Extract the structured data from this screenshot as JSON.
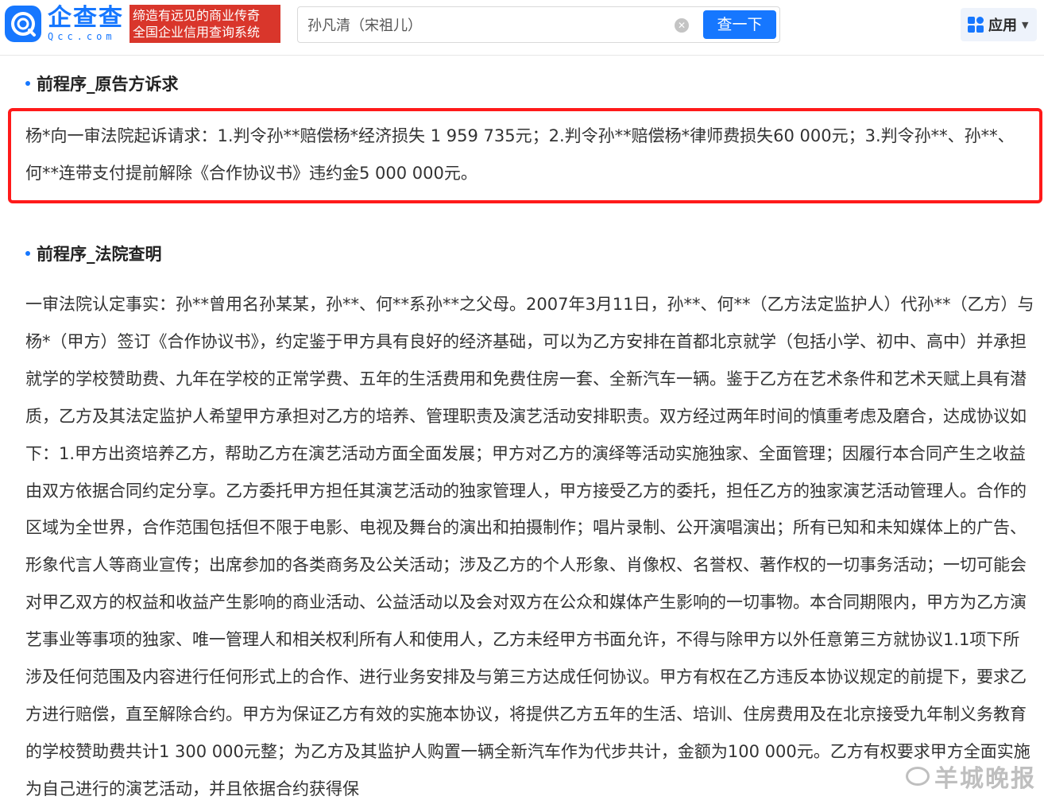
{
  "header": {
    "logo_cn": "企查查",
    "logo_en": "Qcc.com",
    "slogan_line1": "缔造有远见的商业传奇",
    "slogan_line2": "全国企业信用查询系统",
    "search_value": "孙凡清（宋祖儿）",
    "search_button": "查一下",
    "apps_label": "应用",
    "brand_color": "#1677ff",
    "slogan_color": "#d9362b"
  },
  "sections": {
    "plaintiff_title": "前程序_原告方诉求",
    "plaintiff_claim": "杨*向一审法院起诉请求：1.判令孙**赔偿杨*经济损失 1 959 735元；2.判令孙**赔偿杨*律师费损失60 000元；3.判令孙**、孙**、何**连带支付提前解除《合作协议书》违约金5 000 000元。",
    "court_title": "前程序_法院查明",
    "court_facts": "一审法院认定事实：孙**曾用名孙某某，孙**、何**系孙**之父母。2007年3月11日，孙**、何**（乙方法定监护人）代孙**（乙方）与杨*（甲方）签订《合作协议书》，约定鉴于甲方具有良好的经济基础，可以为乙方安排在首都北京就学（包括小学、初中、高中）并承担就学的学校赞助费、九年在学校的正常学费、五年的生活费用和免费住房一套、全新汽车一辆。鉴于乙方在艺术条件和艺术天赋上具有潜质，乙方及其法定监护人希望甲方承担对乙方的培养、管理职责及演艺活动安排职责。双方经过两年时间的慎重考虑及磨合，达成协议如下：1.甲方出资培养乙方，帮助乙方在演艺活动方面全面发展；甲方对乙方的演绎等活动实施独家、全面管理；因履行本合同产生之收益由双方依据合同约定分享。乙方委托甲方担任其演艺活动的独家管理人，甲方接受乙方的委托，担任乙方的独家演艺活动管理人。合作的区域为全世界，合作范围包括但不限于电影、电视及舞台的演出和拍摄制作；唱片录制、公开演唱演出；所有已知和未知媒体上的广告、形象代言人等商业宣传；出席参加的各类商务及公关活动；涉及乙方的个人形象、肖像权、名誉权、著作权的一切事务活动；一切可能会对甲乙双方的权益和收益产生影响的商业活动、公益活动以及会对双方在公众和媒体产生影响的一切事物。本合同期限内，甲方为乙方演艺事业等事项的独家、唯一管理人和相关权利所有人和使用人，乙方未经甲方书面允许，不得与除甲方以外任意第三方就协议1.1项下所涉及任何范围及内容进行任何形式上的合作、进行业务安排及与第三方达成任何协议。甲方有权在乙方违反本协议规定的前提下，要求乙方进行赔偿，直至解除合约。甲方为保证乙方有效的实施本协议，将提供乙方五年的生活、培训、住房费用及在北京接受九年制义务教育的学校赞助费共计1 300 000元整；为乙方及其监护人购置一辆全新汽车作为代步共计，金额为100 000元。乙方有权要求甲方全面实施为自己进行的演艺活动，并且依据合约获得保"
  },
  "watermark": {
    "text": "羊城晚报"
  }
}
